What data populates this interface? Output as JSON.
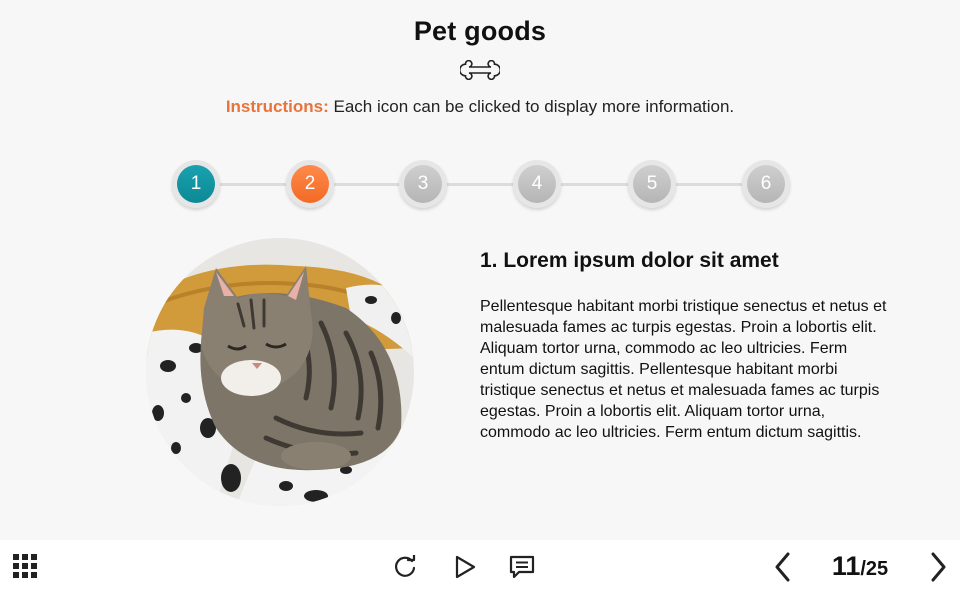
{
  "page": {
    "title": "Pet goods",
    "instructions_label": "Instructions:",
    "instructions_text": " Each icon can be clicked to display more information."
  },
  "steps": [
    {
      "label": "1",
      "state": "active"
    },
    {
      "label": "2",
      "state": "visited"
    },
    {
      "label": "3",
      "state": "default"
    },
    {
      "label": "4",
      "state": "default"
    },
    {
      "label": "5",
      "state": "default"
    },
    {
      "label": "6",
      "state": "default"
    }
  ],
  "content": {
    "title": "1. Lorem ipsum dolor sit amet",
    "body": "Pellentesque habitant morbi tristique senectus et netus et malesuada fames ac turpis egestas. Proin a lobortis elit. Aliquam tortor urna, commodo ac leo ultricies. Ferm entum dictum sagittis. Pellentesque habitant morbi tristique senectus et netus et malesuada fames ac turpis egestas. Proin a lobortis elit. Aliquam tortor urna, commodo ac leo ultricies. Ferm entum dictum sagittis.",
    "image": "sleeping-tabby-cat-photo"
  },
  "footer": {
    "current_page": "11",
    "total_pages": "/25",
    "icons": [
      "menu-grid-icon",
      "replay-icon",
      "play-icon",
      "captions-icon",
      "prev-arrow-icon",
      "next-arrow-icon"
    ]
  },
  "colors": {
    "active": "#13939f",
    "visited": "#f47a36",
    "default": "#c4c4c4",
    "instructions_label": "#e8743b"
  }
}
